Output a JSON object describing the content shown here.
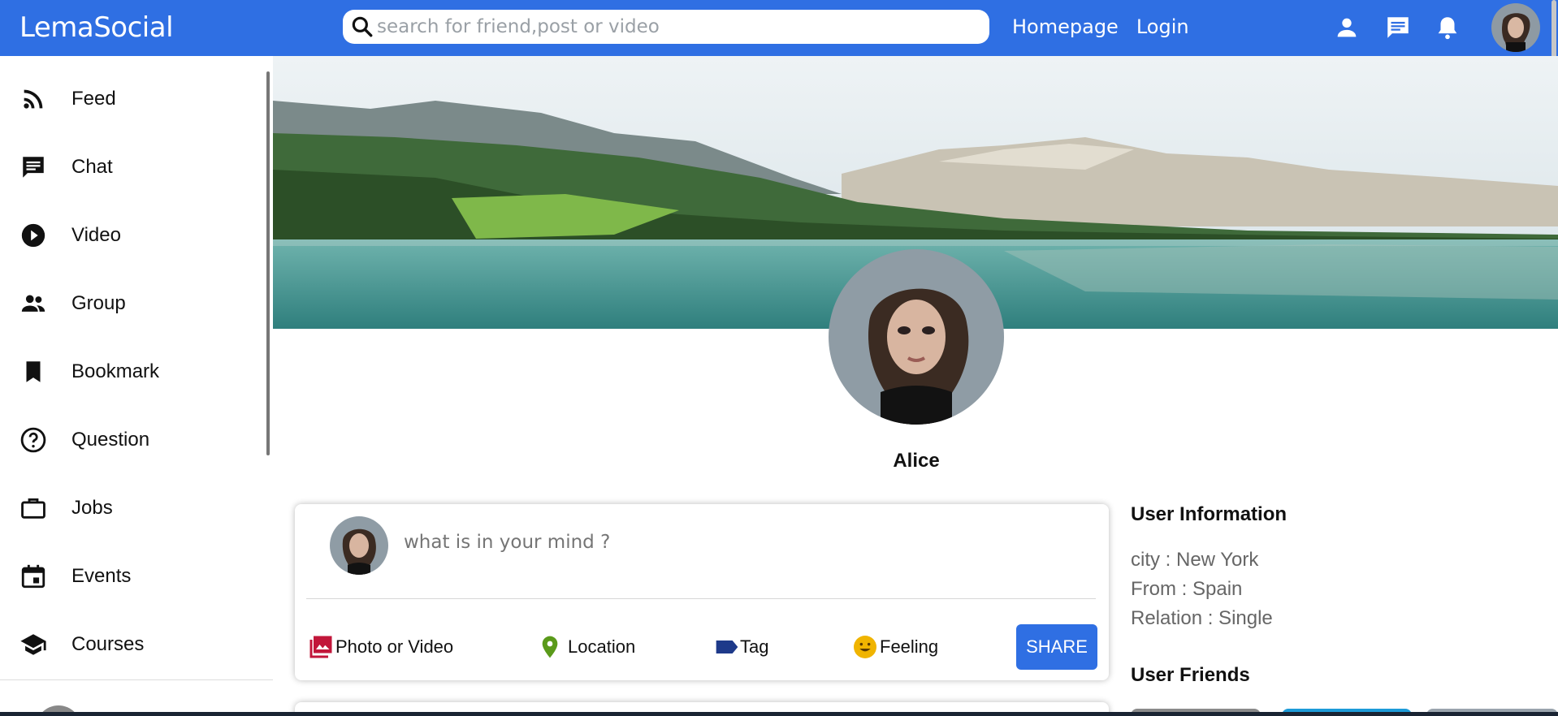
{
  "app": {
    "name": "LemaSocial"
  },
  "search": {
    "placeholder": "search for friend,post or video"
  },
  "nav": {
    "links": [
      {
        "label": "Homepage"
      },
      {
        "label": "Login"
      }
    ]
  },
  "top_icons": [
    "person-icon",
    "chat-icon",
    "notification-icon"
  ],
  "sidebar": {
    "items": [
      {
        "label": "Feed",
        "icon": "rss-feed-icon"
      },
      {
        "label": "Chat",
        "icon": "chat-icon"
      },
      {
        "label": "Video",
        "icon": "play-circle-icon"
      },
      {
        "label": "Group",
        "icon": "group-icon"
      },
      {
        "label": "Bookmark",
        "icon": "bookmark-icon"
      },
      {
        "label": "Question",
        "icon": "help-circle-icon"
      },
      {
        "label": "Jobs",
        "icon": "briefcase-icon"
      },
      {
        "label": "Events",
        "icon": "calendar-icon"
      },
      {
        "label": "Courses",
        "icon": "school-icon"
      }
    ]
  },
  "profile": {
    "name": "Alice"
  },
  "share": {
    "placeholder": "what is in your mind ?",
    "options": [
      {
        "label": "Photo or Video",
        "icon": "photo-library-icon",
        "color": "#c2163a"
      },
      {
        "label": "Location",
        "icon": "location-pin-icon",
        "color": "#5a9a1a"
      },
      {
        "label": "Tag",
        "icon": "label-icon",
        "color": "#1e3a8a"
      },
      {
        "label": "Feeling",
        "icon": "emoji-icon",
        "color": "#f0b400"
      }
    ],
    "button_label": "SHARE"
  },
  "user_info": {
    "title": "User Information",
    "lines": [
      "city : New York",
      "From : Spain",
      "Relation : Single"
    ]
  },
  "friends": {
    "title": "User Friends"
  },
  "colors": {
    "brand": "#2f6fe3",
    "text_muted": "#666666"
  }
}
